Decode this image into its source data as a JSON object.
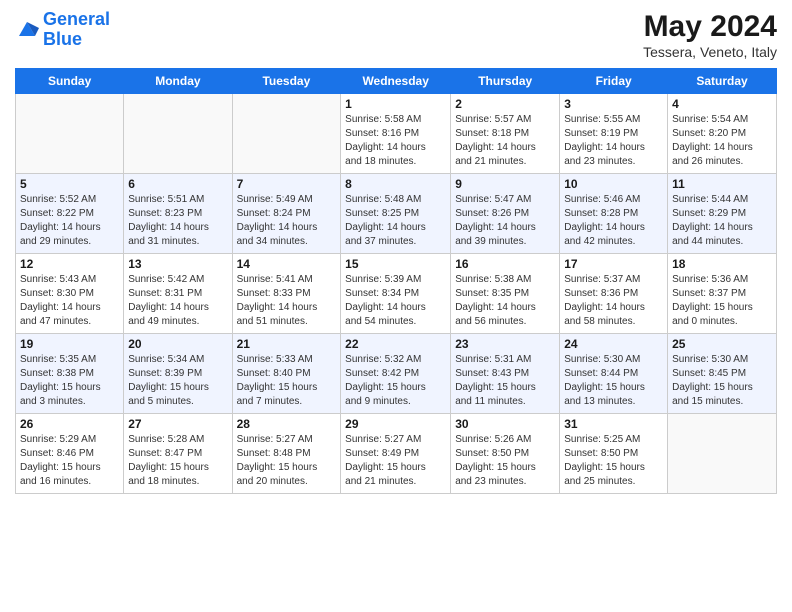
{
  "logo": {
    "line1": "General",
    "line2": "Blue"
  },
  "header": {
    "month": "May 2024",
    "location": "Tessera, Veneto, Italy"
  },
  "days_of_week": [
    "Sunday",
    "Monday",
    "Tuesday",
    "Wednesday",
    "Thursday",
    "Friday",
    "Saturday"
  ],
  "weeks": [
    [
      {
        "day": "",
        "info": ""
      },
      {
        "day": "",
        "info": ""
      },
      {
        "day": "",
        "info": ""
      },
      {
        "day": "1",
        "info": "Sunrise: 5:58 AM\nSunset: 8:16 PM\nDaylight: 14 hours\nand 18 minutes."
      },
      {
        "day": "2",
        "info": "Sunrise: 5:57 AM\nSunset: 8:18 PM\nDaylight: 14 hours\nand 21 minutes."
      },
      {
        "day": "3",
        "info": "Sunrise: 5:55 AM\nSunset: 8:19 PM\nDaylight: 14 hours\nand 23 minutes."
      },
      {
        "day": "4",
        "info": "Sunrise: 5:54 AM\nSunset: 8:20 PM\nDaylight: 14 hours\nand 26 minutes."
      }
    ],
    [
      {
        "day": "5",
        "info": "Sunrise: 5:52 AM\nSunset: 8:22 PM\nDaylight: 14 hours\nand 29 minutes."
      },
      {
        "day": "6",
        "info": "Sunrise: 5:51 AM\nSunset: 8:23 PM\nDaylight: 14 hours\nand 31 minutes."
      },
      {
        "day": "7",
        "info": "Sunrise: 5:49 AM\nSunset: 8:24 PM\nDaylight: 14 hours\nand 34 minutes."
      },
      {
        "day": "8",
        "info": "Sunrise: 5:48 AM\nSunset: 8:25 PM\nDaylight: 14 hours\nand 37 minutes."
      },
      {
        "day": "9",
        "info": "Sunrise: 5:47 AM\nSunset: 8:26 PM\nDaylight: 14 hours\nand 39 minutes."
      },
      {
        "day": "10",
        "info": "Sunrise: 5:46 AM\nSunset: 8:28 PM\nDaylight: 14 hours\nand 42 minutes."
      },
      {
        "day": "11",
        "info": "Sunrise: 5:44 AM\nSunset: 8:29 PM\nDaylight: 14 hours\nand 44 minutes."
      }
    ],
    [
      {
        "day": "12",
        "info": "Sunrise: 5:43 AM\nSunset: 8:30 PM\nDaylight: 14 hours\nand 47 minutes."
      },
      {
        "day": "13",
        "info": "Sunrise: 5:42 AM\nSunset: 8:31 PM\nDaylight: 14 hours\nand 49 minutes."
      },
      {
        "day": "14",
        "info": "Sunrise: 5:41 AM\nSunset: 8:33 PM\nDaylight: 14 hours\nand 51 minutes."
      },
      {
        "day": "15",
        "info": "Sunrise: 5:39 AM\nSunset: 8:34 PM\nDaylight: 14 hours\nand 54 minutes."
      },
      {
        "day": "16",
        "info": "Sunrise: 5:38 AM\nSunset: 8:35 PM\nDaylight: 14 hours\nand 56 minutes."
      },
      {
        "day": "17",
        "info": "Sunrise: 5:37 AM\nSunset: 8:36 PM\nDaylight: 14 hours\nand 58 minutes."
      },
      {
        "day": "18",
        "info": "Sunrise: 5:36 AM\nSunset: 8:37 PM\nDaylight: 15 hours\nand 0 minutes."
      }
    ],
    [
      {
        "day": "19",
        "info": "Sunrise: 5:35 AM\nSunset: 8:38 PM\nDaylight: 15 hours\nand 3 minutes."
      },
      {
        "day": "20",
        "info": "Sunrise: 5:34 AM\nSunset: 8:39 PM\nDaylight: 15 hours\nand 5 minutes."
      },
      {
        "day": "21",
        "info": "Sunrise: 5:33 AM\nSunset: 8:40 PM\nDaylight: 15 hours\nand 7 minutes."
      },
      {
        "day": "22",
        "info": "Sunrise: 5:32 AM\nSunset: 8:42 PM\nDaylight: 15 hours\nand 9 minutes."
      },
      {
        "day": "23",
        "info": "Sunrise: 5:31 AM\nSunset: 8:43 PM\nDaylight: 15 hours\nand 11 minutes."
      },
      {
        "day": "24",
        "info": "Sunrise: 5:30 AM\nSunset: 8:44 PM\nDaylight: 15 hours\nand 13 minutes."
      },
      {
        "day": "25",
        "info": "Sunrise: 5:30 AM\nSunset: 8:45 PM\nDaylight: 15 hours\nand 15 minutes."
      }
    ],
    [
      {
        "day": "26",
        "info": "Sunrise: 5:29 AM\nSunset: 8:46 PM\nDaylight: 15 hours\nand 16 minutes."
      },
      {
        "day": "27",
        "info": "Sunrise: 5:28 AM\nSunset: 8:47 PM\nDaylight: 15 hours\nand 18 minutes."
      },
      {
        "day": "28",
        "info": "Sunrise: 5:27 AM\nSunset: 8:48 PM\nDaylight: 15 hours\nand 20 minutes."
      },
      {
        "day": "29",
        "info": "Sunrise: 5:27 AM\nSunset: 8:49 PM\nDaylight: 15 hours\nand 21 minutes."
      },
      {
        "day": "30",
        "info": "Sunrise: 5:26 AM\nSunset: 8:50 PM\nDaylight: 15 hours\nand 23 minutes."
      },
      {
        "day": "31",
        "info": "Sunrise: 5:25 AM\nSunset: 8:50 PM\nDaylight: 15 hours\nand 25 minutes."
      },
      {
        "day": "",
        "info": ""
      }
    ]
  ]
}
